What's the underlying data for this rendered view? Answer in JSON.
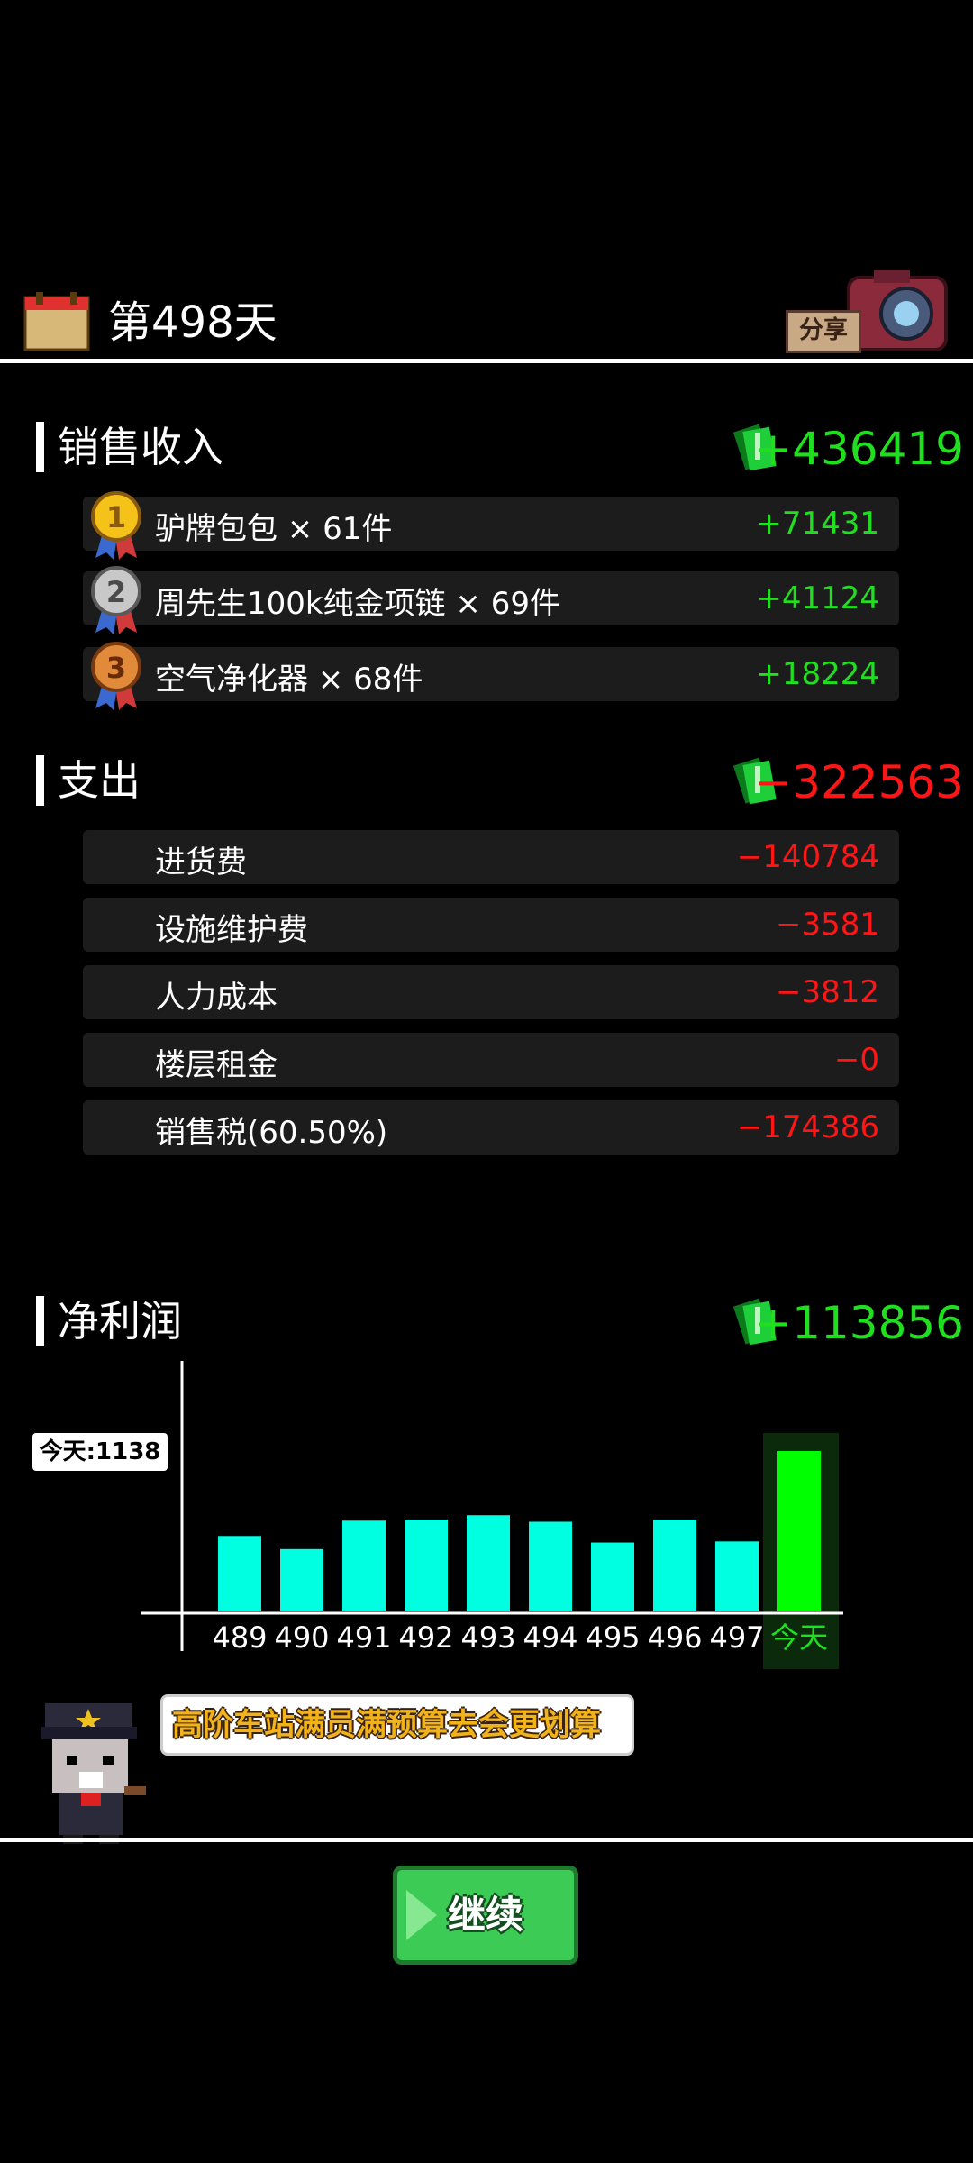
{
  "header": {
    "day_title": "第498天",
    "share_label": "分享"
  },
  "income": {
    "title": "销售收入",
    "total": "+436419",
    "items": [
      {
        "rank": "1",
        "label": "驴牌包包 × 61件",
        "value": "+71431"
      },
      {
        "rank": "2",
        "label": "周先生100k纯金项链 × 69件",
        "value": "+41124"
      },
      {
        "rank": "3",
        "label": "空气净化器 × 68件",
        "value": "+18224"
      }
    ]
  },
  "expense": {
    "title": "支出",
    "total": "−322563",
    "items": [
      {
        "label": "进货费",
        "value": "−140784"
      },
      {
        "label": "设施维护费",
        "value": "−3581"
      },
      {
        "label": "人力成本",
        "value": "−3812"
      },
      {
        "label": "楼层租金",
        "value": "−0"
      },
      {
        "label": "销售税(60.50%)",
        "value": "−174386"
      }
    ]
  },
  "profit": {
    "title": "净利润",
    "total": "+113856",
    "today_badge": "今天:1138"
  },
  "chart_data": {
    "type": "bar",
    "categories": [
      "489",
      "490",
      "491",
      "492",
      "493",
      "494",
      "495",
      "496",
      "497",
      "今天"
    ],
    "values": [
      69,
      57,
      83,
      84,
      88,
      82,
      63,
      84,
      64,
      1138
    ],
    "highlight": "今天",
    "colors": {
      "bar": "#00ffe0",
      "today": "#00ff00",
      "today_label": "#1fdf1f"
    }
  },
  "tip": {
    "text": "高阶车站满员满预算去会更划算"
  },
  "continue_label": "继续",
  "colors": {
    "positive": "#1fdf1f",
    "negative": "#ff1515",
    "row_bg": "#1c1c1c"
  }
}
